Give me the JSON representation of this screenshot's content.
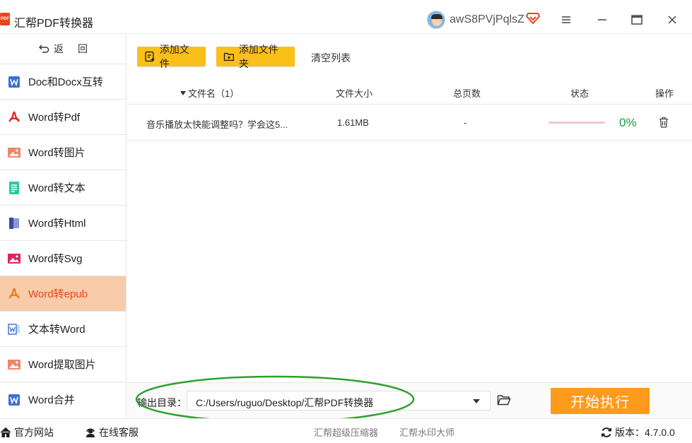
{
  "app": {
    "title": "汇帮PDF转换器",
    "logo_text": "PDF",
    "username": "awS8PVjPqlsZ"
  },
  "sidebar": {
    "back_label": "返",
    "back_label2": "回",
    "items": [
      {
        "label": "Doc和Docx互转",
        "icon": "word-w-icon",
        "active": false
      },
      {
        "label": "Word转Pdf",
        "icon": "pdf-icon",
        "active": false
      },
      {
        "label": "Word转图片",
        "icon": "image-icon",
        "active": false
      },
      {
        "label": "Word转文本",
        "icon": "text-doc-icon",
        "active": false
      },
      {
        "label": "Word转Html",
        "icon": "html-book-icon",
        "active": false
      },
      {
        "label": "Word转Svg",
        "icon": "svg-image-icon",
        "active": false
      },
      {
        "label": "Word转epub",
        "icon": "epub-icon",
        "active": true
      },
      {
        "label": "文本转Word",
        "icon": "text-to-word-icon",
        "active": false
      },
      {
        "label": "Word提取图片",
        "icon": "extract-image-icon",
        "active": false
      },
      {
        "label": "Word合并",
        "icon": "word-merge-icon",
        "active": false
      }
    ]
  },
  "toolbar": {
    "add_file": "添加文件",
    "add_folder": "添加文件夹",
    "clear_list": "清空列表"
  },
  "table": {
    "headers": {
      "filename": "文件名（1）",
      "size": "文件大小",
      "pages": "总页数",
      "status": "状态",
      "actions": "操作"
    },
    "rows": [
      {
        "filename": "音乐播放太快能调整吗？学会这5...",
        "size": "1.61MB",
        "pages": "-",
        "progress_pct": "0%"
      }
    ]
  },
  "output": {
    "label": "输出目录：",
    "path": "C:/Users/ruguo/Desktop/汇帮PDF转换器",
    "start_label": "开始执行"
  },
  "footer": {
    "website": "官方网站",
    "support": "在线客服",
    "link1": "汇帮超级压缩器",
    "link2": "汇帮水印大师",
    "version_label": "版本：",
    "version": "4.7.0.0"
  },
  "colors": {
    "accent_yellow": "#fbbf19",
    "start_orange": "#fe9a1c",
    "active_bg": "#f8ccaa",
    "active_text": "#e8461c",
    "progress_green": "#1a9a3a",
    "annotation_green": "#2ea02e"
  }
}
